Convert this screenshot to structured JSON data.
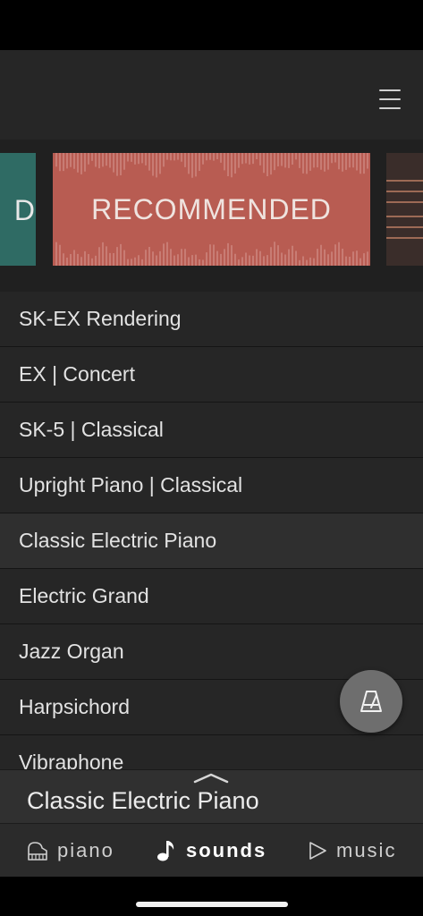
{
  "carousel": {
    "left_card_text": "D",
    "center_card_text": "RECOMMENDED",
    "colors": {
      "left": "#2f6b64",
      "center": "#b85c52",
      "right": "#3a2d2a"
    }
  },
  "sounds": [
    {
      "label": "SK-EX Rendering"
    },
    {
      "label": "EX | Concert"
    },
    {
      "label": "SK-5 | Classical"
    },
    {
      "label": "Upright Piano | Classical"
    },
    {
      "label": "Classic Electric Piano",
      "selected": true
    },
    {
      "label": "Electric Grand"
    },
    {
      "label": "Jazz Organ"
    },
    {
      "label": "Harpsichord"
    },
    {
      "label": "Vibraphone"
    }
  ],
  "fab": {
    "icon": "metronome-icon"
  },
  "now_playing": {
    "title": "Classic Electric Piano",
    "expand_icon": "chevron-up-icon"
  },
  "tabs": {
    "piano": {
      "label": "piano",
      "icon": "piano-icon"
    },
    "sounds": {
      "label": "sounds",
      "icon": "music-note-icon",
      "active": true
    },
    "music": {
      "label": "music",
      "icon": "play-outline-icon"
    }
  }
}
